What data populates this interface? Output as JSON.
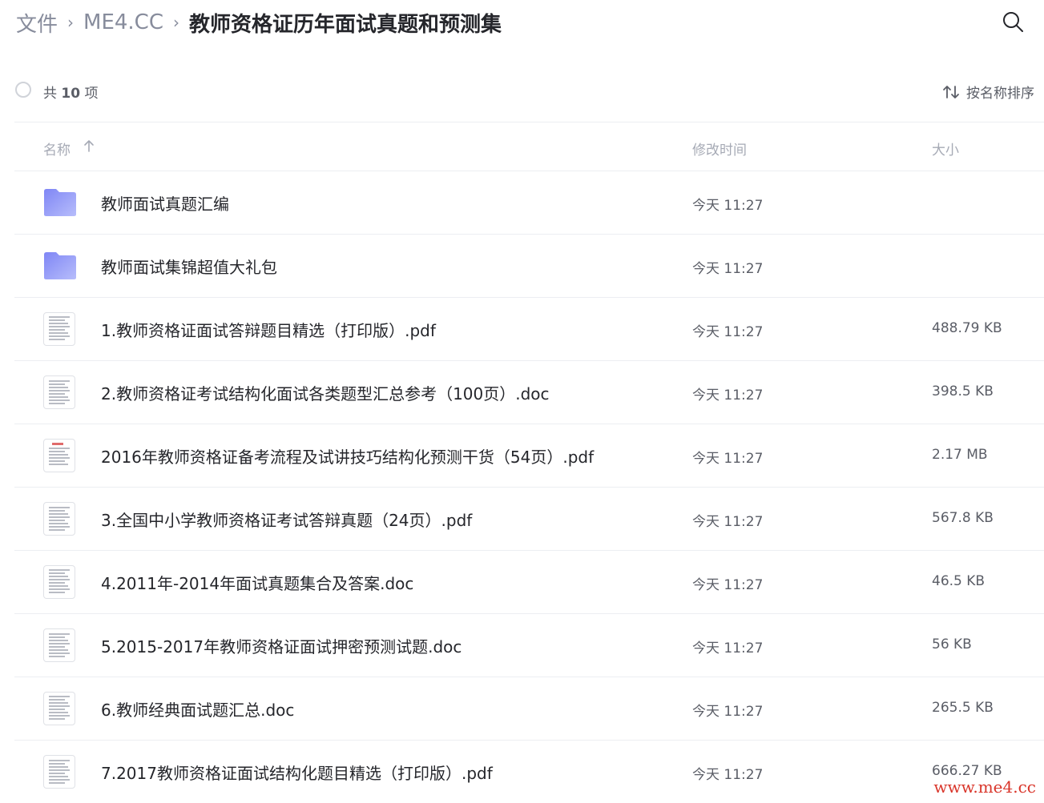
{
  "breadcrumb": {
    "items": [
      "文件",
      "ME4.CC"
    ],
    "current": "教师资格证历年面试真题和预测集",
    "separator": "›"
  },
  "toolbar": {
    "count_prefix": "共",
    "count_value": "10",
    "count_suffix": "项",
    "sort_label": "按名称排序"
  },
  "table": {
    "headers": {
      "name": "名称",
      "time": "修改时间",
      "size": "大小"
    },
    "rows": [
      {
        "type": "folder",
        "name": "教师面试真题汇编",
        "time": "今天 11:27",
        "size": ""
      },
      {
        "type": "folder",
        "name": "教师面试集锦超值大礼包",
        "time": "今天 11:27",
        "size": ""
      },
      {
        "type": "file",
        "name": "1.教师资格证面试答辩题目精选（打印版）.pdf",
        "time": "今天 11:27",
        "size": "488.79 KB"
      },
      {
        "type": "file",
        "name": "2.教师资格证考试结构化面试各类题型汇总参考（100页）.doc",
        "time": "今天 11:27",
        "size": "398.5 KB"
      },
      {
        "type": "file",
        "name": "2016年教师资格证备考流程及试讲技巧结构化预测干货（54页）.pdf",
        "time": "今天 11:27",
        "size": "2.17 MB"
      },
      {
        "type": "file",
        "name": "3.全国中小学教师资格证考试答辩真题（24页）.pdf",
        "time": "今天 11:27",
        "size": "567.8 KB"
      },
      {
        "type": "file",
        "name": "4.2011年-2014年面试真题集合及答案.doc",
        "time": "今天 11:27",
        "size": "46.5 KB"
      },
      {
        "type": "file",
        "name": "5.2015-2017年教师资格证面试押密预测试题.doc",
        "time": "今天 11:27",
        "size": "56 KB"
      },
      {
        "type": "file",
        "name": "6.教师经典面试题汇总.doc",
        "time": "今天 11:27",
        "size": "265.5 KB"
      },
      {
        "type": "file",
        "name": "7.2017教师资格证面试结构化题目精选（打印版）.pdf",
        "time": "今天 11:27",
        "size": "666.27 KB"
      }
    ]
  },
  "watermark": "www.me4.cc",
  "colors": {
    "folder_start": "#7f86f5",
    "folder_end": "#b7bdfb",
    "watermark": "#d9362b"
  }
}
